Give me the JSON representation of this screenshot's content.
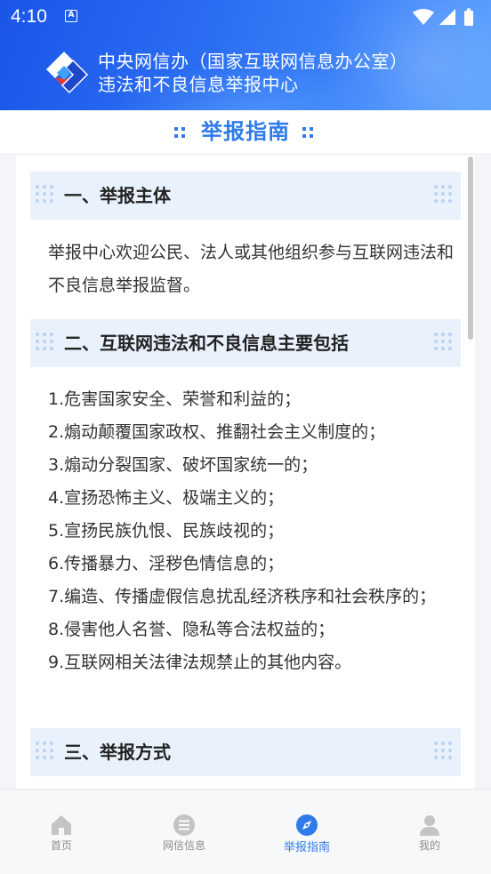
{
  "status_bar": {
    "time": "4:10",
    "notification_icon": "a-badge-icon"
  },
  "header": {
    "title_line1": "中央网信办（国家互联网信息办公室）",
    "title_line2": "违法和不良信息举报中心"
  },
  "guide": {
    "title": "举报指南"
  },
  "sections": [
    {
      "heading": "一、举报主体"
    },
    {
      "heading": "二、互联网违法和不良信息主要包括"
    },
    {
      "heading": "三、举报方式"
    }
  ],
  "intro": "举报中心欢迎公民、法人或其他组织参与互联网违法和不良信息举报监督。",
  "items": [
    "1.危害国家安全、荣誉和利益的；",
    "2.煽动颠覆国家政权、推翻社会主义制度的；",
    "3.煽动分裂国家、破坏国家统一的；",
    "4.宣扬恐怖主义、极端主义的；",
    "5.宣扬民族仇恨、民族歧视的；",
    "6.传播暴力、淫秽色情信息的；",
    "7.编造、传播虚假信息扰乱经济秩序和社会秩序的；",
    "8.侵害他人名誉、隐私等合法权益的；",
    "9.互联网相关法律法规禁止的其他内容。"
  ],
  "tabs": [
    {
      "label": "首页",
      "icon": "home-icon"
    },
    {
      "label": "网信信息",
      "icon": "list-icon"
    },
    {
      "label": "举报指南",
      "icon": "compass-icon"
    },
    {
      "label": "我的",
      "icon": "person-icon"
    }
  ],
  "colors": {
    "accent": "#2f7bea",
    "header_start": "#1a55e8",
    "header_end": "#5aa2ff",
    "section_bg": "#e9f1fc"
  }
}
